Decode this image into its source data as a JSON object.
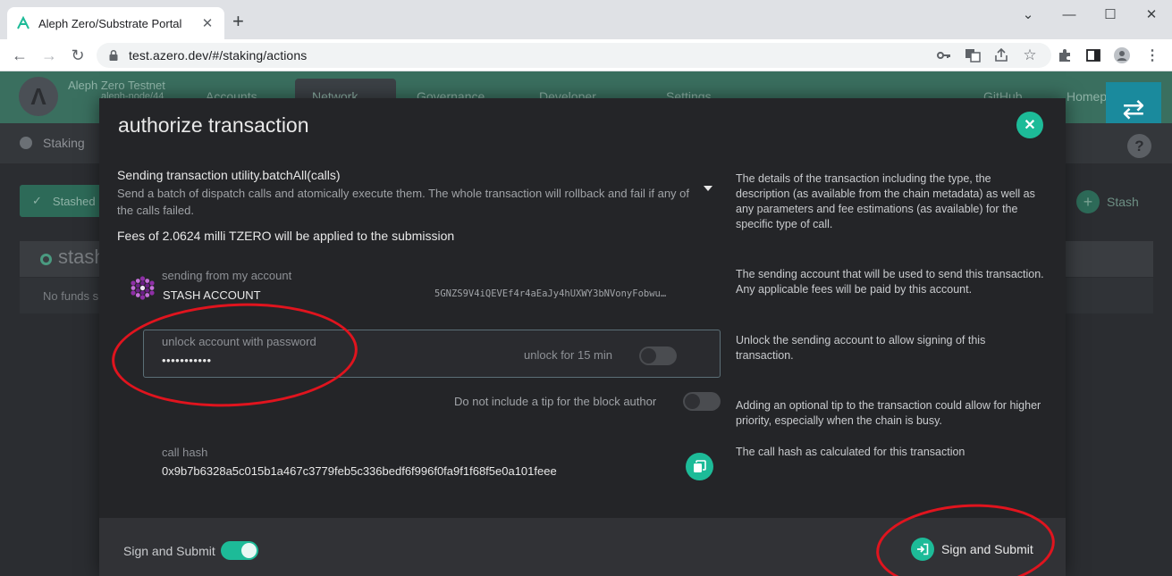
{
  "browser": {
    "tab_title": "Aleph Zero/Substrate Portal",
    "tab_close": "✕",
    "new_tab": "+",
    "url": "test.azero.dev/#/staking/actions",
    "window_controls": {
      "minimize": "—",
      "maximize": "☐",
      "close": "✕",
      "tabsearch": "⌄"
    }
  },
  "app": {
    "chain_name": "Aleph Zero Testnet",
    "chain_node": "aleph-node/44",
    "menu": [
      "Accounts",
      "Network",
      "Governance",
      "Developer",
      "Settings"
    ],
    "right_links": [
      "GitHub",
      "Homepage"
    ],
    "sub_title": "Staking",
    "stashed_label": "Stashed",
    "stash_button": "Stash",
    "stash_panel_title": "stash",
    "nofunds_text": "No funds s"
  },
  "modal": {
    "title": "authorize transaction",
    "sending_title": "Sending transaction utility.batchAll(calls)",
    "sending_desc": "Send a batch of dispatch calls and atomically execute them. The whole transaction will rollback and fail if any of the calls failed.",
    "fees": "Fees of 2.0624 milli TZERO will be applied to the submission",
    "help": {
      "details": "The details of the transaction including the type, the description (as available from the chain metadata) as well as any parameters and fee estimations (as available) for the specific type of call.",
      "sending": "The sending account that will be used to send this transaction. Any applicable fees will be paid by this account.",
      "unlock": "Unlock the sending account to allow signing of this transaction.",
      "tip": "Adding an optional tip to the transaction could allow for higher priority, especially when the chain is busy.",
      "callhash": "The call hash as calculated for this transaction"
    },
    "account": {
      "label": "sending from my account",
      "name": "STASH ACCOUNT",
      "address": "5GNZS9V4iQEVEf4r4aEaJy4hUXWY3bNVonyFobwu…"
    },
    "password": {
      "label": "unlock account with password",
      "value": "•••••••••••",
      "unlock_label": "unlock for 15 min",
      "unlock_enabled": false
    },
    "tip": {
      "label": "Do not include a tip for the block author",
      "enabled": false
    },
    "callhash": {
      "label": "call hash",
      "value": "0x9b7b6328a5c015b1a467c3779feb5c336bedf6f996f0fa9f1f68f5e0a101feee"
    },
    "footer": {
      "sign_label": "Sign and Submit",
      "sign_enabled": true,
      "submit_button": "Sign and Submit"
    }
  },
  "colors": {
    "accent": "#1dbb98",
    "annotation": "#e0141e",
    "modal_bg": "#242528"
  }
}
